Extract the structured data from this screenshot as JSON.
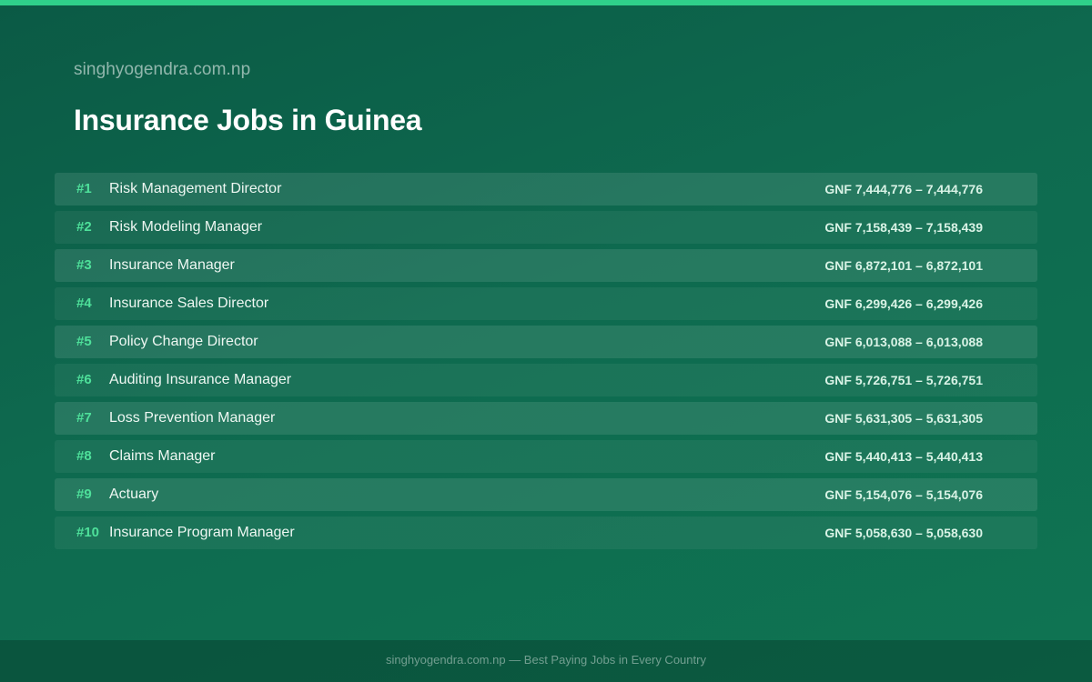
{
  "header": {
    "site": "singhyogendra.com.np",
    "title": "Insurance Jobs in Guinea"
  },
  "jobs": [
    {
      "rank": "#1",
      "title": "Risk Management Director",
      "salary": "GNF 7,444,776 – 7,444,776"
    },
    {
      "rank": "#2",
      "title": "Risk Modeling Manager",
      "salary": "GNF 7,158,439 – 7,158,439"
    },
    {
      "rank": "#3",
      "title": "Insurance Manager",
      "salary": "GNF 6,872,101 – 6,872,101"
    },
    {
      "rank": "#4",
      "title": "Insurance Sales Director",
      "salary": "GNF 6,299,426 – 6,299,426"
    },
    {
      "rank": "#5",
      "title": "Policy Change Director",
      "salary": "GNF 6,013,088 – 6,013,088"
    },
    {
      "rank": "#6",
      "title": "Auditing Insurance Manager",
      "salary": "GNF 5,726,751 – 5,726,751"
    },
    {
      "rank": "#7",
      "title": "Loss Prevention Manager",
      "salary": "GNF 5,631,305 – 5,631,305"
    },
    {
      "rank": "#8",
      "title": "Claims Manager",
      "salary": "GNF 5,440,413 – 5,440,413"
    },
    {
      "rank": "#9",
      "title": "Actuary",
      "salary": "GNF 5,154,076 – 5,154,076"
    },
    {
      "rank": "#10",
      "title": "Insurance Program Manager",
      "salary": "GNF 5,058,630 – 5,058,630"
    }
  ],
  "footer": {
    "text": "singhyogendra.com.np — Best Paying Jobs in Every Country"
  },
  "colors": {
    "background": "#0e6a4f",
    "accent": "#2fd08a",
    "rank": "#4ee09a"
  }
}
